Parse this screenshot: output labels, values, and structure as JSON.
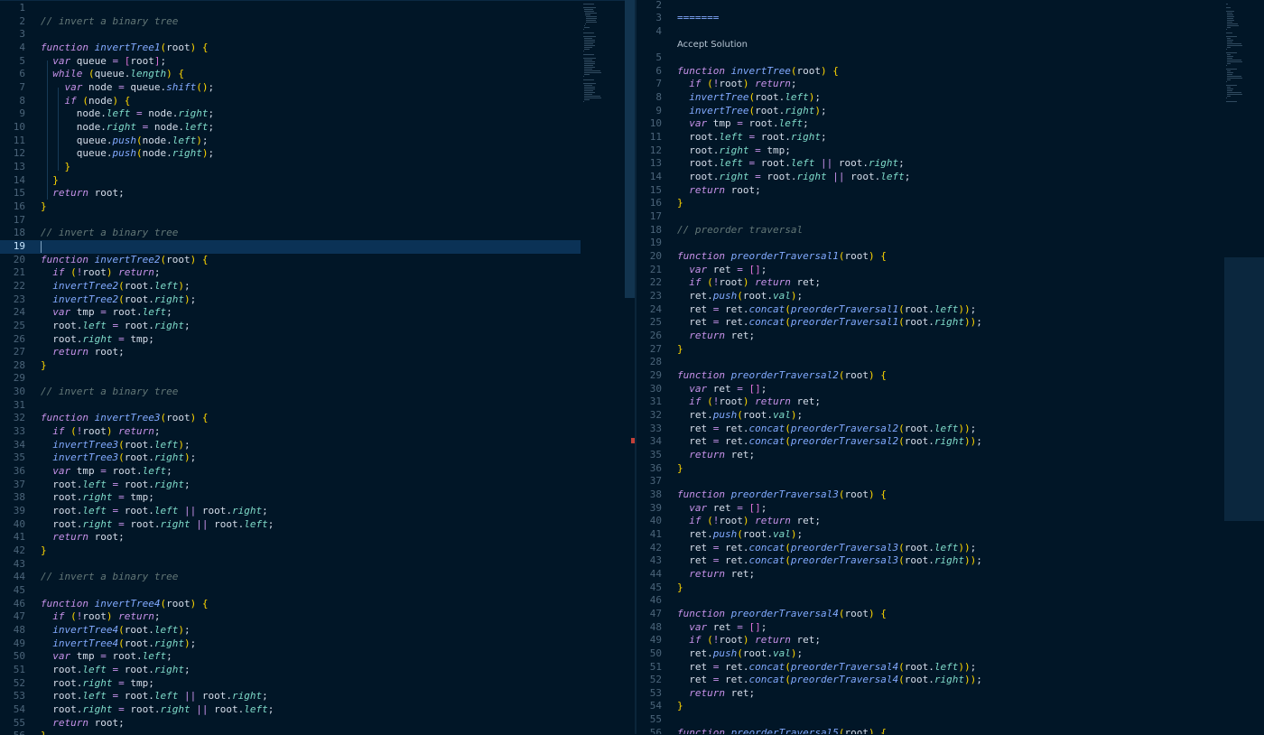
{
  "editor": {
    "left_pane": {
      "active_line": "19",
      "lines": [
        {
          "n": "1",
          "t": ""
        },
        {
          "n": "2",
          "t": "// invert a binary tree"
        },
        {
          "n": "3",
          "t": ""
        },
        {
          "n": "4",
          "t": "function invertTree1(root) {"
        },
        {
          "n": "5",
          "t": "  var queue = [root];"
        },
        {
          "n": "6",
          "t": "  while (queue.length) {"
        },
        {
          "n": "7",
          "t": "    var node = queue.shift();"
        },
        {
          "n": "8",
          "t": "    if (node) {"
        },
        {
          "n": "9",
          "t": "      node.left = node.right;"
        },
        {
          "n": "10",
          "t": "      node.right = node.left;"
        },
        {
          "n": "11",
          "t": "      queue.push(node.left);"
        },
        {
          "n": "12",
          "t": "      queue.push(node.right);"
        },
        {
          "n": "13",
          "t": "    }"
        },
        {
          "n": "14",
          "t": "  }"
        },
        {
          "n": "15",
          "t": "  return root;"
        },
        {
          "n": "16",
          "t": "}"
        },
        {
          "n": "17",
          "t": ""
        },
        {
          "n": "18",
          "t": "// invert a binary tree"
        },
        {
          "n": "19",
          "t": ""
        },
        {
          "n": "20",
          "t": "function invertTree2(root) {"
        },
        {
          "n": "21",
          "t": "  if (!root) return;"
        },
        {
          "n": "22",
          "t": "  invertTree2(root.left);"
        },
        {
          "n": "23",
          "t": "  invertTree2(root.right);"
        },
        {
          "n": "24",
          "t": "  var tmp = root.left;"
        },
        {
          "n": "25",
          "t": "  root.left = root.right;"
        },
        {
          "n": "26",
          "t": "  root.right = tmp;"
        },
        {
          "n": "27",
          "t": "  return root;"
        },
        {
          "n": "28",
          "t": "}"
        },
        {
          "n": "29",
          "t": ""
        },
        {
          "n": "30",
          "t": "// invert a binary tree"
        },
        {
          "n": "31",
          "t": ""
        },
        {
          "n": "32",
          "t": "function invertTree3(root) {"
        },
        {
          "n": "33",
          "t": "  if (!root) return;"
        },
        {
          "n": "34",
          "t": "  invertTree3(root.left);"
        },
        {
          "n": "35",
          "t": "  invertTree3(root.right);"
        },
        {
          "n": "36",
          "t": "  var tmp = root.left;"
        },
        {
          "n": "37",
          "t": "  root.left = root.right;"
        },
        {
          "n": "38",
          "t": "  root.right = tmp;"
        },
        {
          "n": "39",
          "t": "  root.left = root.left || root.right;"
        },
        {
          "n": "40",
          "t": "  root.right = root.right || root.left;"
        },
        {
          "n": "41",
          "t": "  return root;"
        },
        {
          "n": "42",
          "t": "}"
        },
        {
          "n": "43",
          "t": ""
        },
        {
          "n": "44",
          "t": "// invert a binary tree"
        },
        {
          "n": "45",
          "t": ""
        },
        {
          "n": "46",
          "t": "function invertTree4(root) {"
        },
        {
          "n": "47",
          "t": "  if (!root) return;"
        },
        {
          "n": "48",
          "t": "  invertTree4(root.left);"
        },
        {
          "n": "49",
          "t": "  invertTree4(root.right);"
        },
        {
          "n": "50",
          "t": "  var tmp = root.left;"
        },
        {
          "n": "51",
          "t": "  root.left = root.right;"
        },
        {
          "n": "52",
          "t": "  root.right = tmp;"
        },
        {
          "n": "53",
          "t": "  root.left = root.left || root.right;"
        },
        {
          "n": "54",
          "t": "  root.right = root.right || root.left;"
        },
        {
          "n": "55",
          "t": "  return root;"
        },
        {
          "n": "56",
          "t": "}"
        }
      ]
    },
    "right_pane": {
      "lines": [
        {
          "n": "2",
          "t": ""
        },
        {
          "n": "3",
          "t": "======="
        },
        {
          "n": "4",
          "t": ""
        },
        {
          "n": "",
          "t": "Accept Solution"
        },
        {
          "n": "5",
          "t": ""
        },
        {
          "n": "6",
          "t": "function invertTree(root) {"
        },
        {
          "n": "7",
          "t": "  if (!root) return;"
        },
        {
          "n": "8",
          "t": "  invertTree(root.left);"
        },
        {
          "n": "9",
          "t": "  invertTree(root.right);"
        },
        {
          "n": "10",
          "t": "  var tmp = root.left;"
        },
        {
          "n": "11",
          "t": "  root.left = root.right;"
        },
        {
          "n": "12",
          "t": "  root.right = tmp;"
        },
        {
          "n": "13",
          "t": "  root.left = root.left || root.right;"
        },
        {
          "n": "14",
          "t": "  root.right = root.right || root.left;"
        },
        {
          "n": "15",
          "t": "  return root;"
        },
        {
          "n": "16",
          "t": "}"
        },
        {
          "n": "17",
          "t": ""
        },
        {
          "n": "18",
          "t": "// preorder traversal"
        },
        {
          "n": "19",
          "t": ""
        },
        {
          "n": "20",
          "t": "function preorderTraversal1(root) {"
        },
        {
          "n": "21",
          "t": "  var ret = [];"
        },
        {
          "n": "22",
          "t": "  if (!root) return ret;"
        },
        {
          "n": "23",
          "t": "  ret.push(root.val);"
        },
        {
          "n": "24",
          "t": "  ret = ret.concat(preorderTraversal1(root.left));"
        },
        {
          "n": "25",
          "t": "  ret = ret.concat(preorderTraversal1(root.right));"
        },
        {
          "n": "26",
          "t": "  return ret;"
        },
        {
          "n": "27",
          "t": "}"
        },
        {
          "n": "28",
          "t": ""
        },
        {
          "n": "29",
          "t": "function preorderTraversal2(root) {"
        },
        {
          "n": "30",
          "t": "  var ret = [];"
        },
        {
          "n": "31",
          "t": "  if (!root) return ret;"
        },
        {
          "n": "32",
          "t": "  ret.push(root.val);"
        },
        {
          "n": "33",
          "t": "  ret = ret.concat(preorderTraversal2(root.left));"
        },
        {
          "n": "34",
          "t": "  ret = ret.concat(preorderTraversal2(root.right));"
        },
        {
          "n": "35",
          "t": "  return ret;"
        },
        {
          "n": "36",
          "t": "}"
        },
        {
          "n": "37",
          "t": ""
        },
        {
          "n": "38",
          "t": "function preorderTraversal3(root) {"
        },
        {
          "n": "39",
          "t": "  var ret = [];"
        },
        {
          "n": "40",
          "t": "  if (!root) return ret;"
        },
        {
          "n": "41",
          "t": "  ret.push(root.val);"
        },
        {
          "n": "42",
          "t": "  ret = ret.concat(preorderTraversal3(root.left));"
        },
        {
          "n": "43",
          "t": "  ret = ret.concat(preorderTraversal3(root.right));"
        },
        {
          "n": "44",
          "t": "  return ret;"
        },
        {
          "n": "45",
          "t": "}"
        },
        {
          "n": "46",
          "t": ""
        },
        {
          "n": "47",
          "t": "function preorderTraversal4(root) {"
        },
        {
          "n": "48",
          "t": "  var ret = [];"
        },
        {
          "n": "49",
          "t": "  if (!root) return ret;"
        },
        {
          "n": "50",
          "t": "  ret.push(root.val);"
        },
        {
          "n": "51",
          "t": "  ret = ret.concat(preorderTraversal4(root.left));"
        },
        {
          "n": "52",
          "t": "  ret = ret.concat(preorderTraversal4(root.right));"
        },
        {
          "n": "53",
          "t": "  return ret;"
        },
        {
          "n": "54",
          "t": "}"
        },
        {
          "n": "55",
          "t": ""
        },
        {
          "n": "56",
          "t": "function preorderTraversal5(root) {"
        }
      ]
    }
  },
  "theme": {
    "background": "#011627",
    "line_highlight": "#0b3256",
    "keyword": "#c792ea",
    "function": "#82aaff",
    "comment": "#637777",
    "bracket": "#ffd700",
    "property": "#7fdbca",
    "text": "#d6deeb"
  }
}
